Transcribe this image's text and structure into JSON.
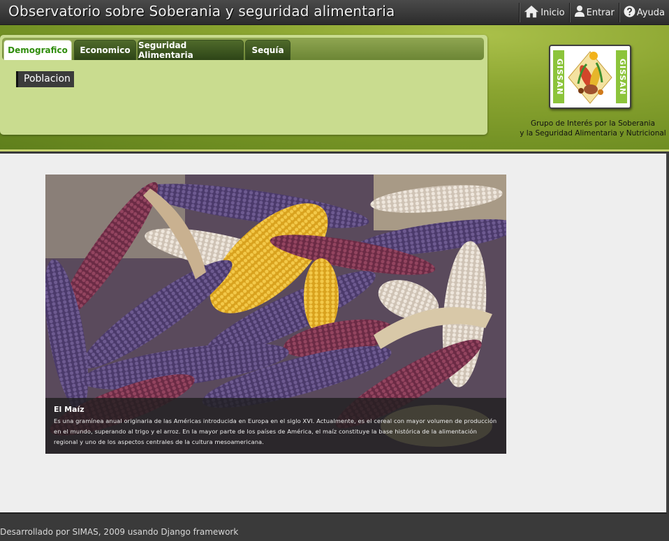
{
  "header": {
    "site_title": "Observatorio sobre Soberania y seguridad alimentaria",
    "nav": [
      {
        "label": "Inicio",
        "icon": "home-icon"
      },
      {
        "label": "Entrar",
        "icon": "user-icon"
      },
      {
        "label": "Ayuda",
        "icon": "help-icon"
      }
    ]
  },
  "tabs": [
    {
      "label": "Demografico",
      "active": true
    },
    {
      "label": "Economico",
      "active": false
    },
    {
      "label": "Seguridad Alimentaria",
      "active": false
    },
    {
      "label": "Sequía",
      "active": false
    }
  ],
  "subnav": {
    "poblacion_label": "Poblacion"
  },
  "logo": {
    "text": "GISSAN",
    "caption_line1": "Grupo de Interés por la Soberania",
    "caption_line2": "y la Seguridad Alimentaria y Nutricional"
  },
  "feature": {
    "title": "El Maíz",
    "text": "Es una gramínea anual originaria de las Américas introducida en Europa en el siglo XVI. Actualmente, es el cereal con mayor volumen de producción en el mundo, superando al trigo y el arroz. En la mayor parte de los países de América, el maíz constituye la base histórica de la alimentación regional y uno de los aspectos centrales de la cultura mesoamericana."
  },
  "footer": {
    "text": "Desarrollado por SIMAS, 2009 usando Django framework"
  },
  "colors": {
    "accent_green": "#2f8d0c",
    "banner_green": "#7b9a27",
    "panel_green": "#c9dc8f"
  }
}
